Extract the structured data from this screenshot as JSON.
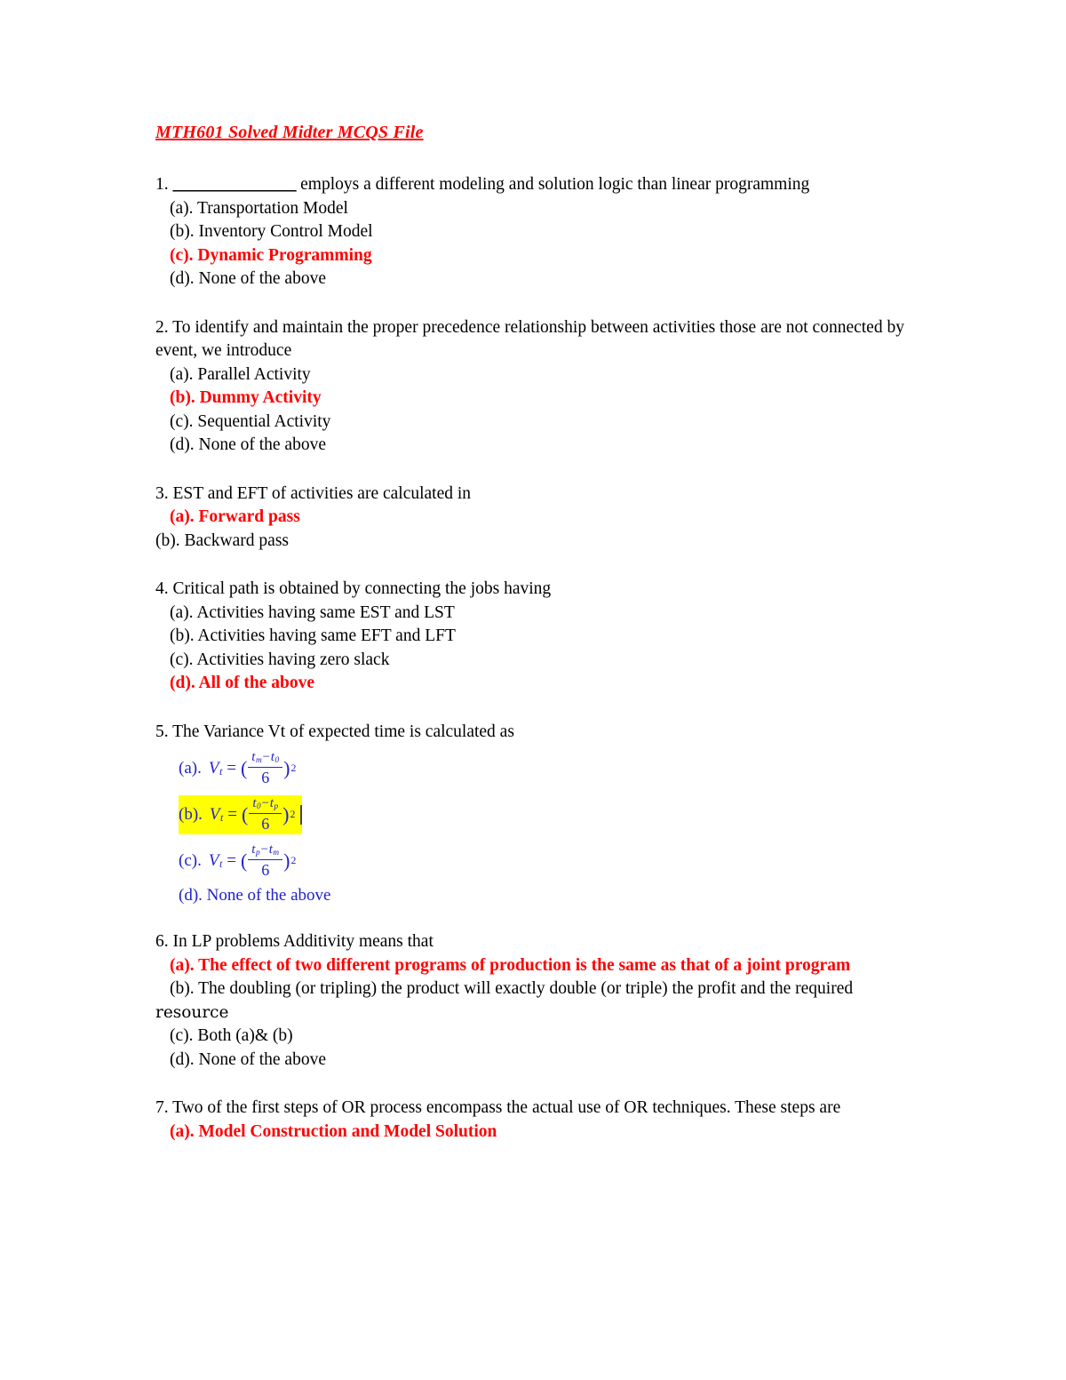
{
  "document": {
    "title": "MTH601 Solved Midter MCQS File",
    "title_color": "#ff0000",
    "correct_answer_color": "#ff0000",
    "formula_color": "#2222cc",
    "highlight_color": "#ffff00"
  },
  "questions": [
    {
      "number": "1.",
      "prompt_prefix": "1.",
      "blank": "_______________",
      "prompt_rest": "employs a different modeling and solution logic than linear programming",
      "options": [
        {
          "label": "(a). Transportation Model",
          "correct": false
        },
        {
          "label": "(b). Inventory Control Model",
          "correct": false
        },
        {
          "label": "(c). Dynamic Programming",
          "correct": true
        },
        {
          "label": "(d). None of the above",
          "correct": false
        }
      ]
    },
    {
      "number": "2.",
      "prompt": "2. To identify and maintain the proper precedence relationship between activities those are not connected by event, we introduce",
      "options": [
        {
          "label": "(a). Parallel Activity",
          "correct": false
        },
        {
          "label": "(b). Dummy Activity",
          "correct": true
        },
        {
          "label": "(c). Sequential Activity",
          "correct": false
        },
        {
          "label": "(d). None of the above",
          "correct": false
        }
      ]
    },
    {
      "number": "3.",
      "prompt": "3. EST and EFT of activities are calculated in",
      "options": [
        {
          "label": "(a). Forward pass",
          "correct": true
        },
        {
          "label": "(b). Backward pass",
          "correct": false
        }
      ]
    },
    {
      "number": "4.",
      "prompt": "4. Critical path is obtained by connecting the jobs having",
      "options": [
        {
          "label": "(a). Activities having same EST and LST",
          "correct": false
        },
        {
          "label": "(b). Activities having same EFT and LFT",
          "correct": false
        },
        {
          "label": "(c). Activities having zero slack",
          "correct": false
        },
        {
          "label": "(d). All of the above",
          "correct": true
        }
      ]
    },
    {
      "number": "5.",
      "prompt": "5. The Variance Vt of expected time is calculated as",
      "math_options": [
        {
          "label": "(a).",
          "lhs_var": "V",
          "lhs_sub": "t",
          "numerator_first_var": "t",
          "numerator_first_sub": "m",
          "numerator_minus": "−",
          "numerator_second_var": "t",
          "numerator_second_sub": "0",
          "denominator": "6",
          "power": "2",
          "highlighted": false
        },
        {
          "label": "(b).",
          "lhs_var": "V",
          "lhs_sub": "t",
          "numerator_first_var": "t",
          "numerator_first_sub": "0",
          "numerator_minus": "−",
          "numerator_second_var": "t",
          "numerator_second_sub": "p",
          "denominator": "6",
          "power": "2",
          "highlighted": true
        },
        {
          "label": "(c).",
          "lhs_var": "V",
          "lhs_sub": "t",
          "numerator_first_var": "t",
          "numerator_first_sub": "p",
          "numerator_minus": "−",
          "numerator_second_var": "t",
          "numerator_second_sub": "m",
          "denominator": "6",
          "power": "2",
          "highlighted": false
        }
      ],
      "last_option": "(d).  None of the above"
    },
    {
      "number": "6.",
      "prompt": "6. In LP problems Additivity means that",
      "options": [
        {
          "label": "(a). The effect of two different programs of production is the same as that of a joint program",
          "correct": true
        },
        {
          "label": "(b). The doubling (or tripling) the product will exactly double (or triple) the profit and the required",
          "correct": false
        },
        {
          "label": "resource",
          "correct": false
        },
        {
          "label": "(c). Both (a)& (b)",
          "correct": false
        },
        {
          "label": "(d). None of the above",
          "correct": false
        }
      ]
    },
    {
      "number": "7.",
      "prompt": "7. Two of the first steps of OR process encompass the actual use of OR techniques. These steps are",
      "options": [
        {
          "label": "(a). Model Construction and Model Solution",
          "correct": true
        }
      ]
    }
  ]
}
